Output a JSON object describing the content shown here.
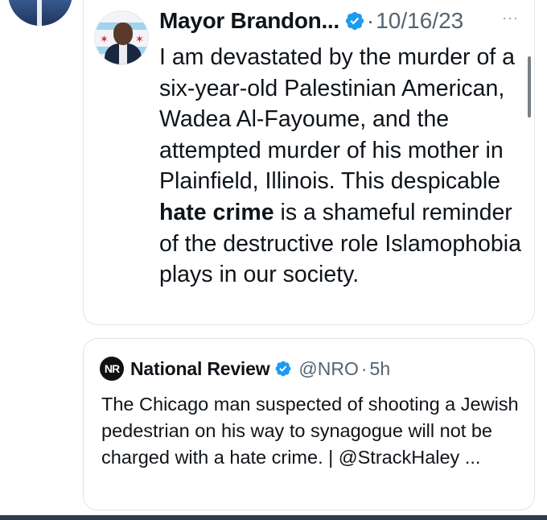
{
  "colors": {
    "verified_blue": "#1d9bf0",
    "text_primary": "#0f1419",
    "text_secondary": "#536471",
    "flag_red": "#d8232a",
    "flag_blue": "#9fd3f0"
  },
  "tweet": {
    "author_name": "Mayor Brandon...",
    "date": "10/16/23",
    "separator": "·",
    "more_icon": "···",
    "text_part1": "I am devastated by the murder of a six-year-old Palestinian American, Wadea Al-Fayoume, and the attempted murder of his mother in Plainfield, Illinois. This despicable ",
    "text_bold": "hate crime",
    "text_part2": " is a shameful reminder of the destructive role Islamophobia plays in our society."
  },
  "quote": {
    "logo_text": "NR",
    "author_name": "National Review",
    "handle": "@NRO",
    "separator": "·",
    "time": "5h",
    "text": "The Chicago man suspected of shooting a Jewish pedestrian on his way to synagogue will not be charged with a hate crime. | @StrackHaley ..."
  },
  "icons": {
    "verified": "verified-badge-icon",
    "more": "more-options-icon"
  }
}
